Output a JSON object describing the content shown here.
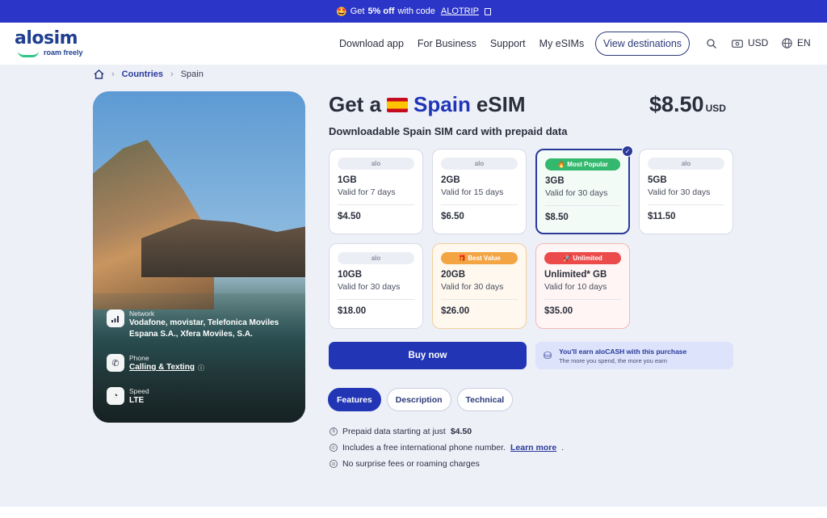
{
  "promo": {
    "emoji": "🤩",
    "prefix": "Get",
    "offer": "5% off",
    "mid": "with code",
    "code": "ALOTRIP"
  },
  "nav": {
    "logo_word": "alosim",
    "logo_tag": "roam freely",
    "links": [
      "Download app",
      "For Business",
      "Support",
      "My eSIMs"
    ],
    "cta": "View destinations",
    "currency": "USD",
    "language": "EN"
  },
  "breadcrumb": {
    "home_icon": "home-icon",
    "countries": "Countries",
    "current": "Spain"
  },
  "hero": {
    "network_label": "Network",
    "network_value": "Vodafone, movistar, Telefonica Moviles Espana S.A., Xfera Moviles, S.A.",
    "phone_label": "Phone",
    "phone_value": "Calling & Texting",
    "speed_label": "Speed",
    "speed_value": "LTE"
  },
  "header": {
    "get_a": "Get a",
    "country": "Spain",
    "esim": "eSIM",
    "price": "$8.50",
    "price_unit": "USD",
    "subtitle": "Downloadable Spain SIM card with prepaid data"
  },
  "plans": [
    {
      "badge": "alo",
      "gb": "1GB",
      "valid": "Valid for 7 days",
      "price": "$4.50"
    },
    {
      "badge": "alo",
      "gb": "2GB",
      "valid": "Valid for 15 days",
      "price": "$6.50"
    },
    {
      "badge": "🔥 Most Popular",
      "gb": "3GB",
      "valid": "Valid for 30 days",
      "price": "$8.50"
    },
    {
      "badge": "alo",
      "gb": "5GB",
      "valid": "Valid for 30 days",
      "price": "$11.50"
    },
    {
      "badge": "alo",
      "gb": "10GB",
      "valid": "Valid for 30 days",
      "price": "$18.00"
    },
    {
      "badge": "🎁 Best Value",
      "gb": "20GB",
      "valid": "Valid for 30 days",
      "price": "$26.00"
    },
    {
      "badge": "🚀 Unlimited",
      "gb": "Unlimited* GB",
      "valid": "Valid for 10 days",
      "price": "$35.00"
    }
  ],
  "actions": {
    "buy": "Buy now",
    "earn_title": "You'll earn aloCASH with this purchase",
    "earn_sub": "The more you spend, the more you earn"
  },
  "tabs": [
    "Features",
    "Description",
    "Technical"
  ],
  "features": {
    "f1_text": "Prepaid data starting at just",
    "f1_price": "$4.50",
    "f2_text": "Includes a free international phone number.",
    "f2_link": "Learn more",
    "f3_text": "No surprise fees or roaming charges"
  }
}
